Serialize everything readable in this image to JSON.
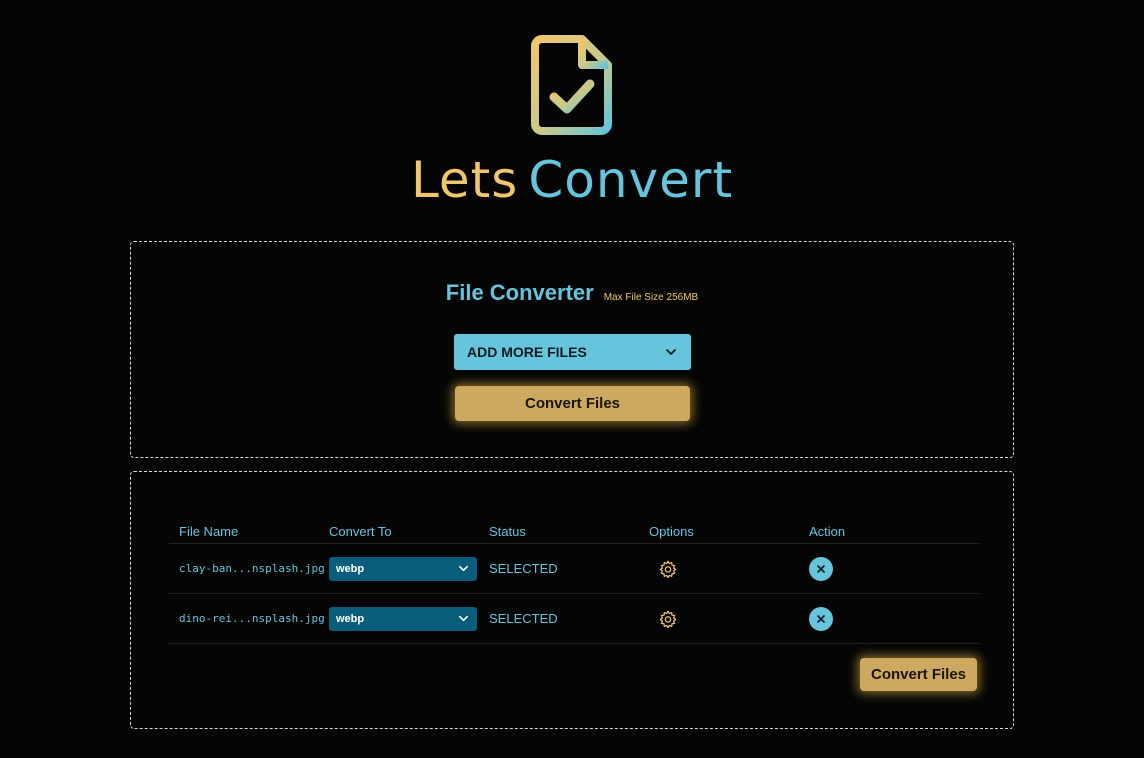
{
  "brand": {
    "word1": "Lets",
    "word2": "Convert"
  },
  "converter": {
    "title": "File Converter",
    "max_size": "Max File Size 256MB",
    "add_files_label": "ADD MORE FILES",
    "convert_label": "Convert Files"
  },
  "table": {
    "headers": {
      "file_name": "File Name",
      "convert_to": "Convert To",
      "status": "Status",
      "options": "Options",
      "action": "Action"
    },
    "rows": [
      {
        "file_name": "clay-ban...nsplash.jpg",
        "convert_to": "webp",
        "status": "SELECTED"
      },
      {
        "file_name": "dino-rei...nsplash.jpg",
        "convert_to": "webp",
        "status": "SELECTED"
      }
    ],
    "convert_label": "Convert Files"
  },
  "colors": {
    "accent_blue": "#66c4dc",
    "accent_gold": "#cda860",
    "select_bg": "#0b5d7c",
    "background": "#050505"
  },
  "icons": {
    "logo": "document-check-icon",
    "dropdown": "chevron-down-icon",
    "options": "gear-icon",
    "remove": "close-icon"
  }
}
